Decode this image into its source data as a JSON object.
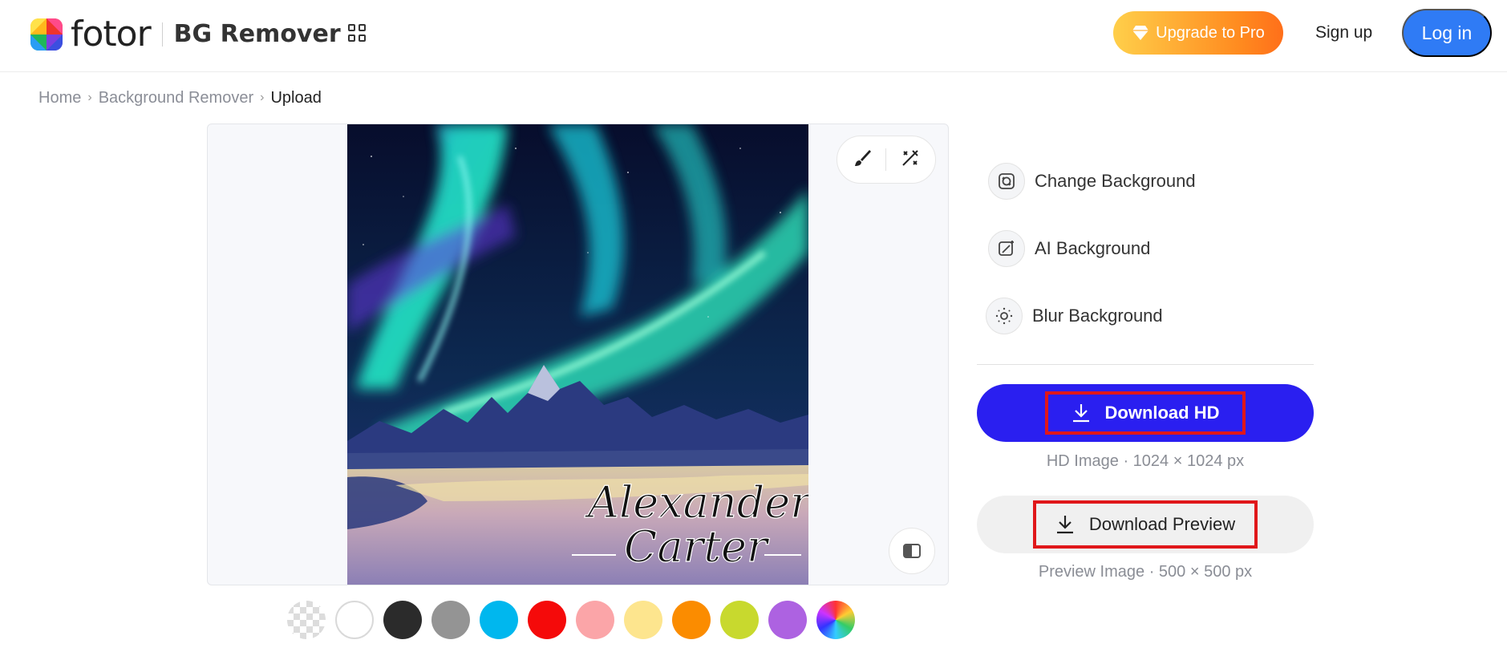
{
  "header": {
    "logo_word": "fotor",
    "product": "BG Remover",
    "upgrade_label": "Upgrade to Pro",
    "signup_label": "Sign up",
    "login_label": "Log in"
  },
  "breadcrumb": {
    "items": [
      "Home",
      "Background Remover"
    ],
    "current": "Upload"
  },
  "canvas": {
    "signature_line1": "Alexander",
    "signature_line2": "Carter"
  },
  "swatches": [
    {
      "name": "transparent",
      "color": "transparent"
    },
    {
      "name": "white",
      "color": "#ffffff"
    },
    {
      "name": "black",
      "color": "#2b2b2b"
    },
    {
      "name": "gray",
      "color": "#949494"
    },
    {
      "name": "sky-blue",
      "color": "#00b7ee"
    },
    {
      "name": "red",
      "color": "#f50a0a"
    },
    {
      "name": "pink",
      "color": "#fba5a8"
    },
    {
      "name": "light-yellow",
      "color": "#fde58e"
    },
    {
      "name": "orange",
      "color": "#fb8c00"
    },
    {
      "name": "lime",
      "color": "#c8d92e"
    },
    {
      "name": "purple",
      "color": "#ad62e1"
    },
    {
      "name": "custom-color",
      "color": "rainbow"
    }
  ],
  "panel": {
    "options": [
      {
        "label": "Change Background",
        "icon": "change-background-icon"
      },
      {
        "label": "AI Background",
        "icon": "ai-background-icon"
      },
      {
        "label": "Blur Background",
        "icon": "blur-background-icon"
      }
    ],
    "download_hd_label": "Download HD",
    "download_hd_sub": "HD Image · 1024 × 1024 px",
    "download_preview_label": "Download Preview",
    "download_preview_sub": "Preview Image · 500 × 500 px"
  },
  "colors": {
    "brand_blue": "#2f7bf5",
    "download_hd_bg": "#2a1ff0",
    "highlight_red": "#e0171a",
    "upgrade_gradient_start": "#ffcf4a",
    "upgrade_gradient_end": "#ff6f1a"
  }
}
